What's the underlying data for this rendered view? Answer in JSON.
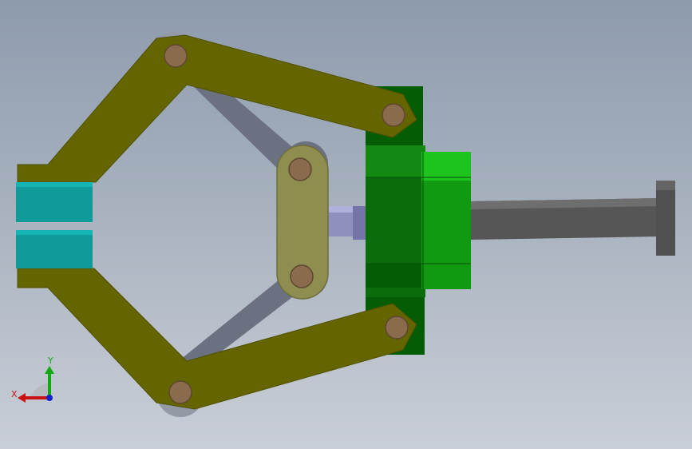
{
  "viewport": {
    "background_top": "#8e9bad",
    "background_bottom": "#c9ced7"
  },
  "colors": {
    "arm": "#656500",
    "arm_stroke": "#4f4f00",
    "coupler": "#8e8e50",
    "link_grey": "#6c7182",
    "pin": "#8a6b4d",
    "pad": "#119a9a",
    "block_dark": "#045c04",
    "block_light": "#12ad12",
    "rod": "#5a5a5a",
    "piston": "#8f8fc0"
  },
  "parts": [
    {
      "name": "upper-gripper-arm",
      "part_type": "lever arm"
    },
    {
      "name": "lower-gripper-arm",
      "part_type": "lever arm"
    },
    {
      "name": "upper-support-link",
      "part_type": "link"
    },
    {
      "name": "lower-support-link",
      "part_type": "link"
    },
    {
      "name": "center-coupler",
      "part_type": "coupler plate"
    },
    {
      "name": "jaw-pad-top",
      "part_type": "gripper pad"
    },
    {
      "name": "jaw-pad-bottom",
      "part_type": "gripper pad"
    },
    {
      "name": "actuator-body",
      "part_type": "housing"
    },
    {
      "name": "piston-rod",
      "part_type": "rod"
    },
    {
      "name": "drive-shaft",
      "part_type": "shaft"
    },
    {
      "name": "end-cap",
      "part_type": "cap"
    }
  ],
  "triad": {
    "x_label": "X",
    "y_label": "Y",
    "x_color": "#cc1111",
    "y_color": "#11aa11",
    "z_color": "#1122cc"
  }
}
